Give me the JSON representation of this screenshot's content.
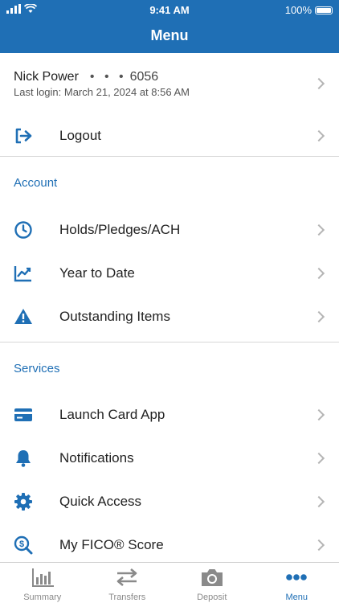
{
  "status_bar": {
    "time": "9:41 AM",
    "battery": "100%"
  },
  "header": {
    "title": "Menu"
  },
  "profile": {
    "name": "Nick Power",
    "masked": "• • •",
    "account_suffix": "6056",
    "last_login": "Last login: March 21, 2024 at 8:56 AM"
  },
  "logout": {
    "label": "Logout",
    "icon": "logout-icon"
  },
  "account": {
    "title": "Account",
    "items": [
      {
        "label": "Holds/Pledges/ACH",
        "icon": "clock-icon"
      },
      {
        "label": "Year to Date",
        "icon": "trend-chart-icon"
      },
      {
        "label": "Outstanding Items",
        "icon": "warning-icon"
      }
    ]
  },
  "services": {
    "title": "Services",
    "items": [
      {
        "label": "Launch Card App",
        "icon": "credit-card-icon"
      },
      {
        "label": "Notifications",
        "icon": "bell-icon"
      },
      {
        "label": "Quick Access",
        "icon": "gear-icon"
      },
      {
        "label": "My FICO® Score",
        "icon": "dollar-search-icon"
      }
    ]
  },
  "tabs": [
    {
      "label": "Summary",
      "icon": "bar-chart-icon"
    },
    {
      "label": "Transfers",
      "icon": "transfer-arrows-icon"
    },
    {
      "label": "Deposit",
      "icon": "camera-icon"
    },
    {
      "label": "Menu",
      "icon": "more-dots-icon",
      "active": true
    }
  ],
  "colors": {
    "primary": "#1f6fb5",
    "chevron": "#b5b5b5",
    "inactive_tab": "#8a8a8a"
  }
}
